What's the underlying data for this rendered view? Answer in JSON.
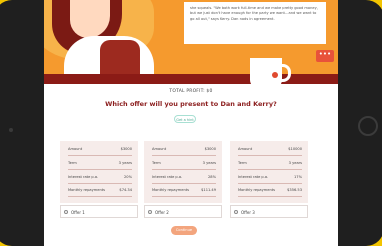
{
  "banner": {
    "speech": "she squeals. \"We both work full-time and we make pretty good money, but we just don't have enough for the party we want…and we want to go all out,\" says Kerry. Dan nods in agreement.",
    "more_label": "•••"
  },
  "profit_label": "TOTAL PROFIT: $0",
  "question": "Which offer will you present to Dan and Kerry?",
  "hint_label": "Get a hint",
  "row_labels": {
    "amount": "Amount",
    "term": "Term",
    "rate": "Interest rate p.a.",
    "repay": "Monthly repayments"
  },
  "offers": [
    {
      "amount": "$3000",
      "term": "3 years",
      "rate": "20%",
      "repay": "$74.34",
      "option": "Offer 1"
    },
    {
      "amount": "$3000",
      "term": "3 years",
      "rate": "28%",
      "repay": "$111.49",
      "option": "Offer 2"
    },
    {
      "amount": "$10000",
      "term": "3 years",
      "rate": "17%",
      "repay": "$356.53",
      "option": "Offer 3"
    }
  ],
  "continue_label": "Continue",
  "colors": {
    "background": "#f2c400",
    "question": "#8b1d1d",
    "continue": "#f3a57e",
    "card": "#f6ecea"
  }
}
